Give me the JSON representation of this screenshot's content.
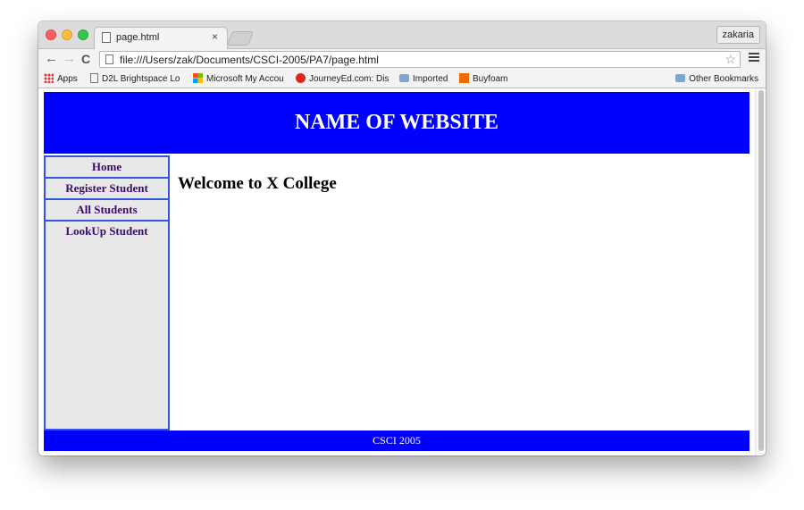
{
  "browser": {
    "tab_title": "page.html",
    "tab_close": "×",
    "profile_name": "zakaria",
    "url": "file:///Users/zak/Documents/CSCI-2005/PA7/page.html",
    "bookmarks": [
      {
        "label": "Apps",
        "icon": "apps-grid-icon"
      },
      {
        "label": "D2L Brightspace Lo",
        "icon": "page-icon"
      },
      {
        "label": "Microsoft My Accou",
        "icon": "microsoft-logo-icon"
      },
      {
        "label": "JourneyEd.com: Dis",
        "icon": "journeyed-icon"
      },
      {
        "label": "Imported",
        "icon": "folder-icon"
      },
      {
        "label": "Buyfoam",
        "icon": "buyfoam-icon"
      }
    ],
    "other_bookmarks": "Other Bookmarks"
  },
  "site": {
    "header_title": "NAME OF WEBSITE",
    "nav": [
      {
        "label": "Home"
      },
      {
        "label": "Register Student"
      },
      {
        "label": "All Students"
      },
      {
        "label": "LookUp Student"
      }
    ],
    "heading": "Welcome to X College",
    "footer": "CSCI 2005"
  },
  "colors": {
    "header_bg": "#0000ff",
    "footer_bg": "#0000ff",
    "sidebar_bg": "#e8e8e8",
    "sidebar_border": "#3355dd",
    "nav_text": "#3b0a6e"
  }
}
